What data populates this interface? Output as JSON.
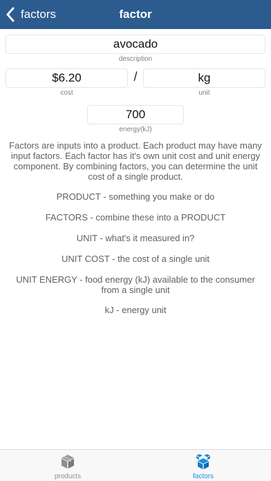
{
  "nav": {
    "back_label": "factors",
    "title": "factor"
  },
  "form": {
    "description_value": "avocado",
    "description_caption": "description",
    "cost_value": "$6.20",
    "cost_caption": "cost",
    "separator": "/",
    "unit_value": "kg",
    "unit_caption": "unit",
    "energy_value": "700",
    "energy_caption": "energy(kJ)"
  },
  "help": {
    "intro": "Factors are inputs into a product.  Each product may have many input factors.  Each factor has it's own unit cost and unit energy component.  By combining factors, you can determine the unit cost of a single product.",
    "product": "PRODUCT - something you make or do",
    "factors": "FACTORS - combine these into a PRODUCT",
    "unit": "UNIT - what's it measured in?",
    "unit_cost": "UNIT COST - the cost of a single unit",
    "unit_energy": "UNIT ENERGY - food energy (kJ) available to the consumer from a single unit",
    "kj": "kJ - energy unit"
  },
  "tabs": [
    {
      "label": "products",
      "icon": "box-icon",
      "active": false
    },
    {
      "label": "factors",
      "icon": "boxes-icon",
      "active": true
    }
  ],
  "colors": {
    "nav_bg": "#2c5b8f",
    "tab_active": "#1a8fe3",
    "tab_inactive": "#8e8e8e"
  }
}
